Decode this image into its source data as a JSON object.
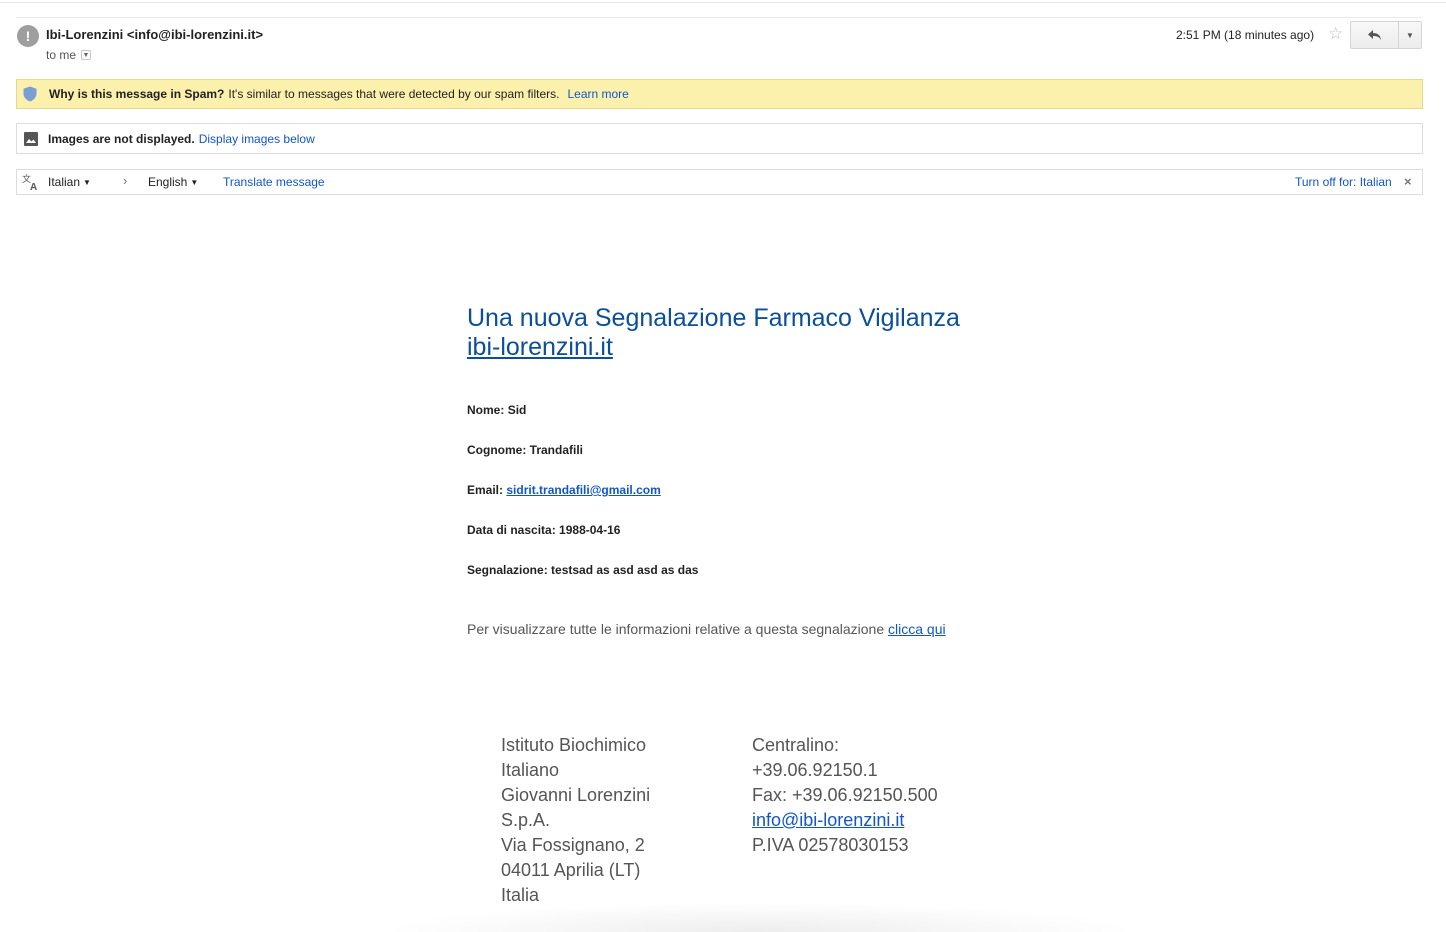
{
  "header": {
    "sender": "Ibi-Lorenzini <info@ibi-lorenzini.it>",
    "recipient": "to me",
    "time": "2:51 PM (18 minutes ago)",
    "icons": {
      "sender": "spam-warning-icon",
      "star": "star-icon",
      "reply": "reply-icon",
      "more": "dropdown-arrow-icon"
    }
  },
  "spam_banner": {
    "bold": "Why is this message in Spam?",
    "text": "It's similar to messages that were detected by our spam filters.",
    "link": "Learn more",
    "color": "#fcf0ad"
  },
  "images_banner": {
    "bold": "Images are not displayed.",
    "link": "Display images below"
  },
  "translate_bar": {
    "from_lang": "Italian",
    "to_lang": "English",
    "translate_link": "Translate message",
    "turn_off": "Turn off for: Italian"
  },
  "email": {
    "title_line": "Una nuova Segnalazione Farmaco Vigilanza",
    "title_link": "ibi-lorenzini.it",
    "fields": [
      {
        "label": "Nome:",
        "value": "Sid"
      },
      {
        "label": "Cognome:",
        "value": "Trandafili"
      },
      {
        "label": "Email:",
        "value": "sidrit.trandafili@gmail.com"
      },
      {
        "label": "Data di nascita:",
        "value": "1988-04-16"
      },
      {
        "label": "Segnalazione:",
        "value": "testsad as asd asd as das"
      }
    ],
    "note": "Per visualizzare tutte le informazioni relative a questa segnalazione",
    "note_link": "clicca qui",
    "footer_left": [
      "Istituto Biochimico",
      "Italiano",
      "Giovanni Lorenzini",
      "S.p.A.",
      "Via Fossignano, 2",
      "04011 Aprilia (LT)",
      "Italia"
    ],
    "footer_right": [
      "Centralino:",
      "+39.06.92150.1",
      "Fax: +39.06.92150.500",
      "info@ibi-lorenzini.it",
      "P.IVA 02578030153"
    ],
    "title_color": "#0b4f9a",
    "link_color": "#1155cc"
  }
}
